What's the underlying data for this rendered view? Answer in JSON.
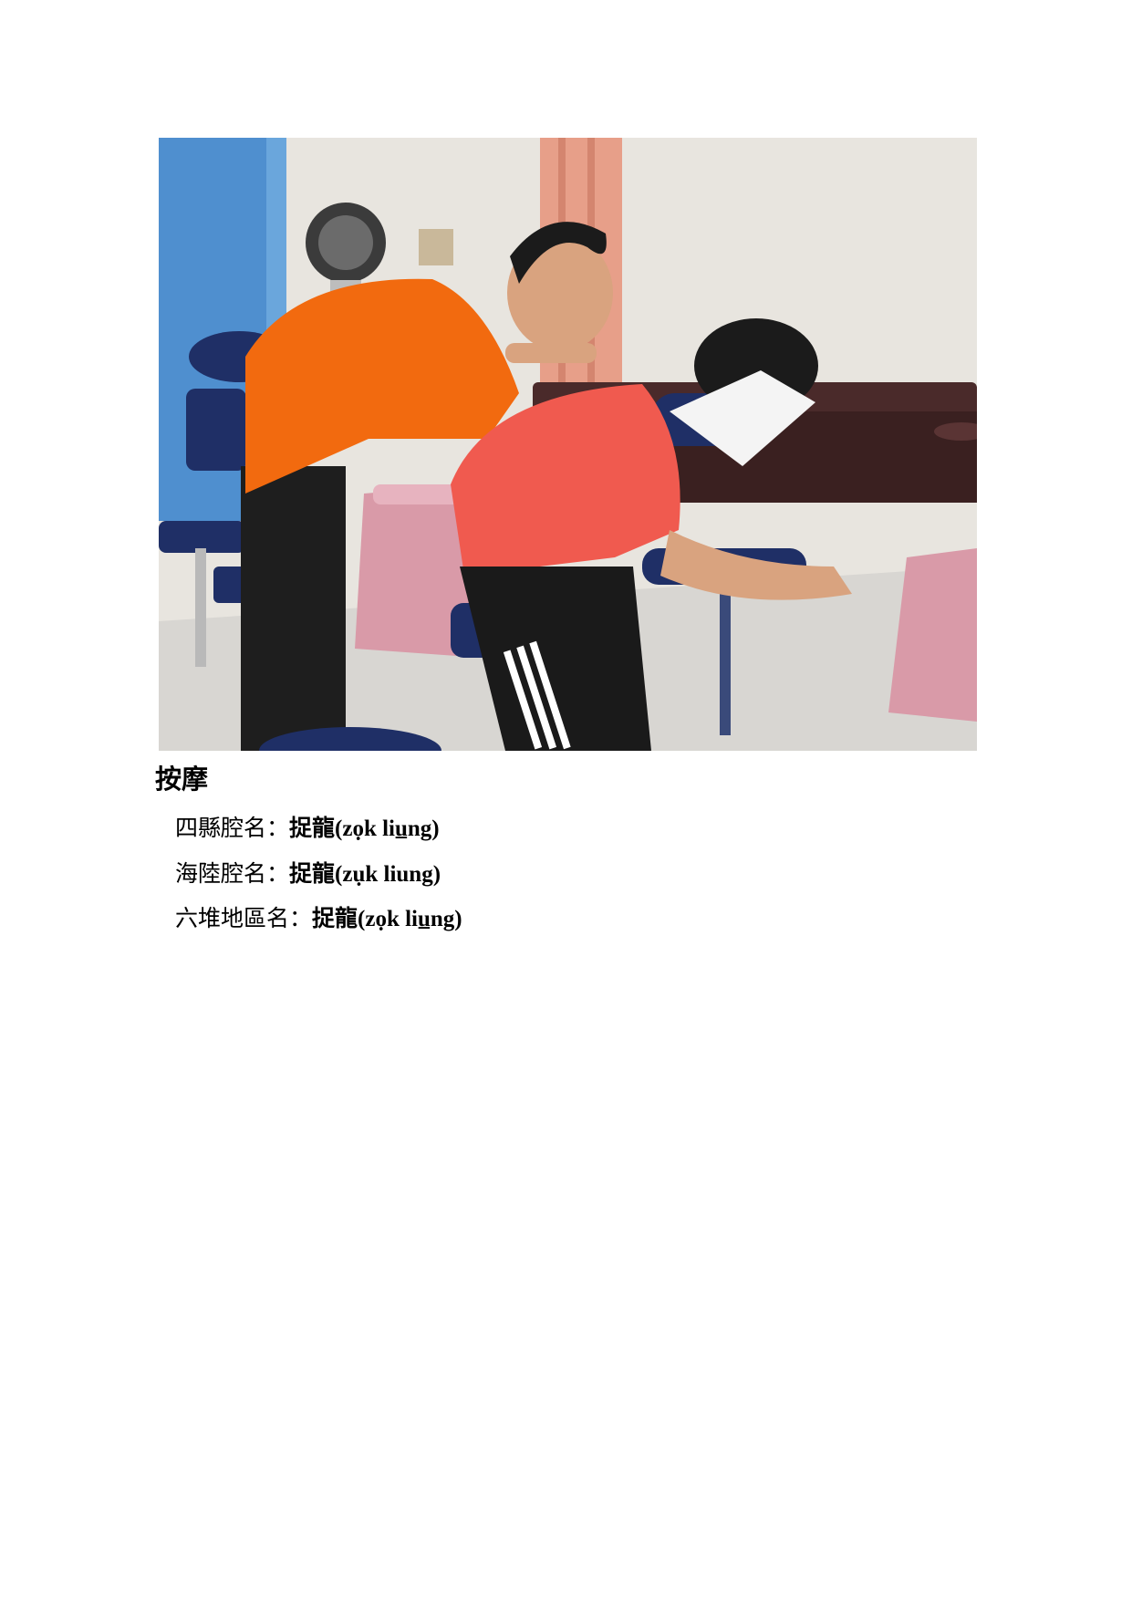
{
  "photo": {
    "alt": "",
    "colors": {
      "wall": "#e8e5df",
      "blue_wall": "#4f8fcf",
      "curtain": "#e79f89",
      "orange_shirt": "#f26a0f",
      "red_shirt": "#f05a4f",
      "chair_pad": "#1f2f66",
      "stool": "#d99aa8",
      "bed": "#4a2a2a",
      "floor": "#d8d6d2"
    }
  },
  "heading": "按摩",
  "entries": [
    {
      "label": "四縣腔名：",
      "hanzi": "捉龍",
      "romanization": "(zọk liu̲ng)"
    },
    {
      "label": "海陸腔名：",
      "hanzi": "捉龍",
      "romanization": "(zụk liung)"
    },
    {
      "label": "六堆地區名：",
      "hanzi": "捉龍",
      "romanization": "(zọk liu̲ng)"
    }
  ]
}
